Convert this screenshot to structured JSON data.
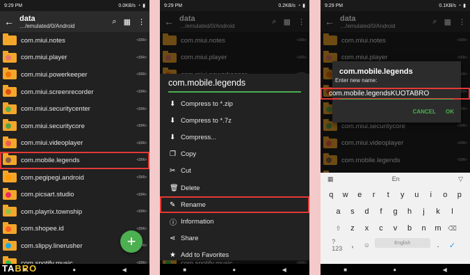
{
  "status": {
    "time": "9:29 PM",
    "speed1": "0.0KB/s",
    "speed2": "0.2KB/s",
    "speed3": "0.1KB/s"
  },
  "toolbar": {
    "title": "data",
    "path": "…/emulated/0/Android"
  },
  "dir_tag": "<DIR>",
  "files": [
    {
      "name": "com.miui.notes",
      "badge": "#f4a62a"
    },
    {
      "name": "com.miui.player",
      "badge": "#e57373"
    },
    {
      "name": "com.miui.powerkeeper",
      "badge": "#ef6c00"
    },
    {
      "name": "com.miui.screenrecorder",
      "badge": "#d84315"
    },
    {
      "name": "com.miui.securitycenter",
      "badge": "#4caf50"
    },
    {
      "name": "com.miui.securitycore",
      "badge": "#43a047"
    },
    {
      "name": "com.miui.videoplayer",
      "badge": "#ef5350"
    },
    {
      "name": "com.mobile.legends",
      "badge": "#795548"
    },
    {
      "name": "com.pegipegi.android",
      "badge": "#ff9800"
    },
    {
      "name": "com.picsart.studio",
      "badge": "#e91e63"
    },
    {
      "name": "com.playrix.township",
      "badge": "#8bc34a"
    },
    {
      "name": "com.shopee.id",
      "badge": "#ff5722"
    },
    {
      "name": "com.slippy.linerusher",
      "badge": "#03a9f4"
    },
    {
      "name": "com.spotify.music",
      "badge": "#1db954"
    }
  ],
  "menu": {
    "title": "com.mobile.legends",
    "items": [
      {
        "icon": "download-icon",
        "glyph": "⬇",
        "label": "Compress to *.zip"
      },
      {
        "icon": "download-icon",
        "glyph": "⬇",
        "label": "Compress to *.7z"
      },
      {
        "icon": "download-icon",
        "glyph": "⬇",
        "label": "Compress..."
      },
      {
        "icon": "copy-icon",
        "glyph": "❐",
        "label": "Copy"
      },
      {
        "icon": "cut-icon",
        "glyph": "✂",
        "label": "Cut"
      },
      {
        "icon": "delete-icon",
        "glyph": "🗑",
        "label": "Delete"
      },
      {
        "icon": "pencil-icon",
        "glyph": "✎",
        "label": "Rename"
      },
      {
        "icon": "info-icon",
        "glyph": "ⓘ",
        "label": "Information"
      },
      {
        "icon": "share-icon",
        "glyph": "⋖",
        "label": "Share"
      },
      {
        "icon": "star-icon",
        "glyph": "★",
        "label": "Add to Favorites"
      }
    ]
  },
  "dialog": {
    "title": "com.mobile.legends",
    "label": "Enter new name:",
    "value": "com.mobile.legendsKUOTABRO",
    "cancel": "CANCEL",
    "ok": "OK"
  },
  "keyboard": {
    "lang": "En",
    "row1": [
      "q",
      "w",
      "e",
      "r",
      "t",
      "y",
      "u",
      "i",
      "o",
      "p"
    ],
    "row2": [
      "a",
      "s",
      "d",
      "f",
      "g",
      "h",
      "j",
      "k",
      "l"
    ],
    "row3": [
      "⇧",
      "z",
      "x",
      "c",
      "v",
      "b",
      "n",
      "m",
      "⌫"
    ],
    "row4": [
      "?123",
      ",",
      "☺",
      "English",
      ".",
      "✓"
    ]
  },
  "watermark": {
    "a": "TA",
    "b": "BRO"
  }
}
